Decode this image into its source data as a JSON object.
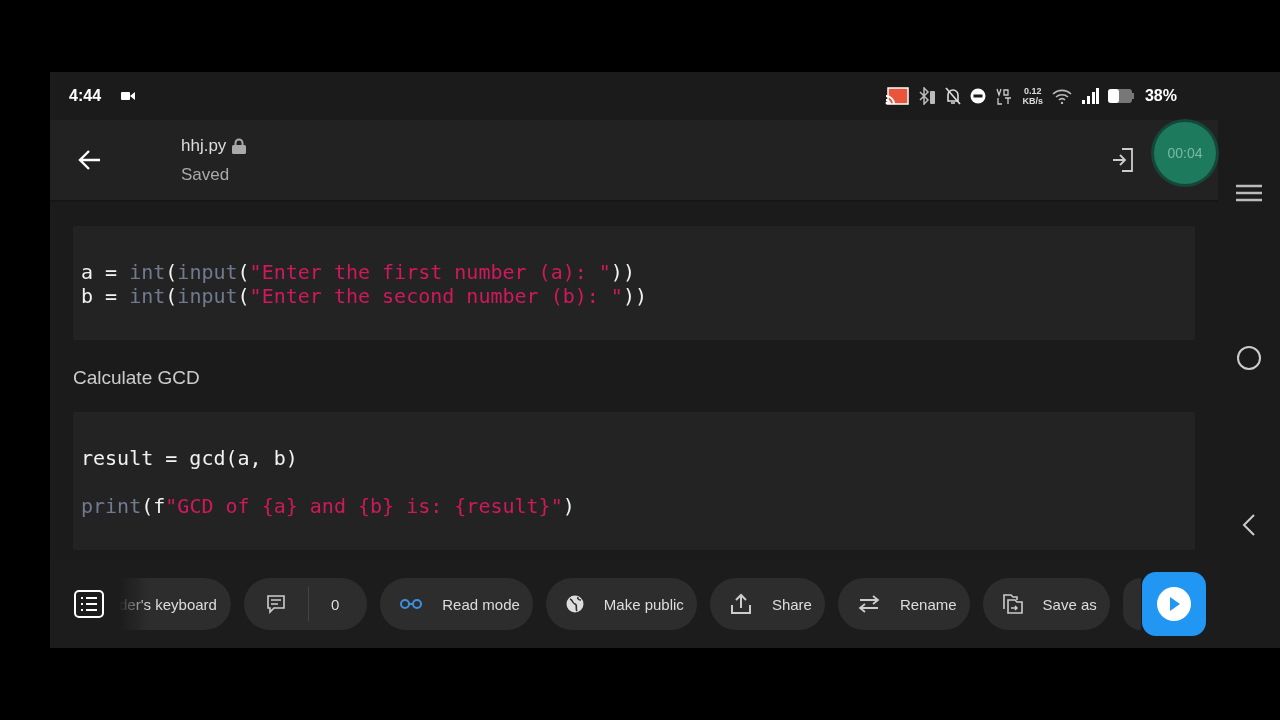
{
  "status_bar": {
    "time": "4:44",
    "net_speed": [
      "0.12",
      "KB/s"
    ],
    "battery": "38%"
  },
  "app_bar": {
    "file_name": "hhj.py",
    "locked": true,
    "save_state": "Saved",
    "timer": "00:04"
  },
  "document": {
    "blocks": [
      {
        "kind": "code",
        "paragraphs": [
          [
            [
              {
                "kind": "plain",
                "text": "a = "
              },
              {
                "kind": "builtin",
                "text": "int"
              },
              {
                "kind": "plain",
                "text": "("
              },
              {
                "kind": "builtin",
                "text": "input"
              },
              {
                "kind": "plain",
                "text": "("
              },
              {
                "kind": "string",
                "text": "\"Enter the first number (a): \""
              },
              {
                "kind": "plain",
                "text": "))"
              }
            ],
            [
              {
                "kind": "plain",
                "text": "b = "
              },
              {
                "kind": "builtin",
                "text": "int"
              },
              {
                "kind": "plain",
                "text": "("
              },
              {
                "kind": "builtin",
                "text": "input"
              },
              {
                "kind": "plain",
                "text": "("
              },
              {
                "kind": "string",
                "text": "\"Enter the second number (b): \""
              },
              {
                "kind": "plain",
                "text": "))"
              }
            ]
          ]
        ]
      },
      {
        "kind": "heading",
        "text": "Calculate GCD"
      },
      {
        "kind": "code",
        "paragraphs": [
          [
            [
              {
                "kind": "plain",
                "text": "result = gcd(a, b)"
              }
            ]
          ],
          [
            [
              {
                "kind": "builtin",
                "text": "print"
              },
              {
                "kind": "plain",
                "text": "(f"
              },
              {
                "kind": "string",
                "text": "\"GCD of {a} and {b} is: {result}\""
              },
              {
                "kind": "plain",
                "text": ")"
              }
            ]
          ]
        ]
      }
    ]
  },
  "toolbar": {
    "items": [
      {
        "kind": "keyboard",
        "label": "der's keyboard"
      },
      {
        "kind": "comments",
        "label": "0"
      },
      {
        "kind": "read",
        "label": "Read mode"
      },
      {
        "kind": "publish",
        "label": "Make public"
      },
      {
        "kind": "share",
        "label": "Share"
      },
      {
        "kind": "rename",
        "label": "Rename"
      },
      {
        "kind": "saveas",
        "label": "Save as"
      }
    ]
  }
}
